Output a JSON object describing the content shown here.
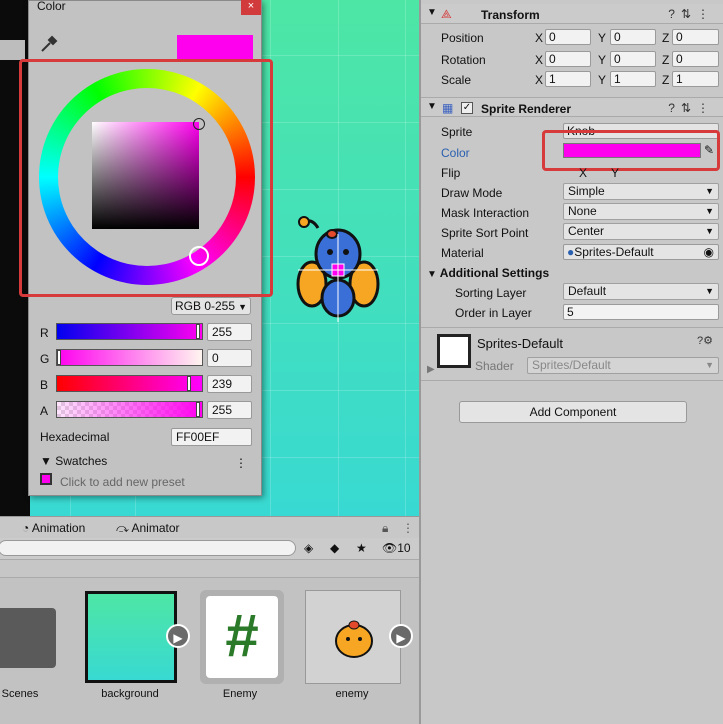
{
  "picker": {
    "title": "Color",
    "close": "×",
    "mode": "RGB 0-255",
    "channels": [
      {
        "label": "R",
        "value": "255",
        "fill": 1.0
      },
      {
        "label": "G",
        "value": "0",
        "fill": 0.0
      },
      {
        "label": "B",
        "value": "239",
        "fill": 0.937
      },
      {
        "label": "A",
        "value": "255",
        "fill": 1.0
      }
    ],
    "hex_label": "Hexadecimal",
    "hex_value": "FF00EF",
    "swatches_label": "Swatches",
    "swatches_more": "⋮",
    "swatch_hint": "Click to add new preset",
    "color": "#ff00ef"
  },
  "bottom": {
    "tabs": [
      "Animation",
      "Animator"
    ],
    "hidden_count": "10",
    "assets": [
      {
        "label": "Scenes",
        "icon": "folder-icon"
      },
      {
        "label": "background",
        "icon": "image-icon"
      },
      {
        "label": "Enemy",
        "icon": "script-icon"
      },
      {
        "label": "enemy",
        "icon": "sprite-icon"
      }
    ]
  },
  "inspector": {
    "transform": {
      "title": "Transform",
      "rows": [
        {
          "label": "Position",
          "x": "0",
          "y": "0",
          "z": "0"
        },
        {
          "label": "Rotation",
          "x": "0",
          "y": "0",
          "z": "0"
        },
        {
          "label": "Scale",
          "x": "1",
          "y": "1",
          "z": "1"
        }
      ],
      "axes": [
        "X",
        "Y",
        "Z"
      ]
    },
    "sprite_renderer": {
      "title": "Sprite Renderer",
      "sprite_label": "Sprite",
      "sprite_value": "Knob",
      "color_label": "Color",
      "flip_label": "Flip",
      "flip_x": "X",
      "flip_y": "Y",
      "draw_mode_label": "Draw Mode",
      "draw_mode_value": "Simple",
      "mask_label": "Mask Interaction",
      "mask_value": "None",
      "sort_point_label": "Sprite Sort Point",
      "sort_point_value": "Center",
      "material_label": "Material",
      "material_value": "Sprites-Default",
      "additional_label": "Additional Settings",
      "sorting_layer_label": "Sorting Layer",
      "sorting_layer_value": "Default",
      "order_label": "Order in Layer",
      "order_value": "5"
    },
    "material": {
      "title": "Sprites-Default",
      "shader_label": "Shader",
      "shader_value": "Sprites/Default"
    },
    "add_component": "Add Component"
  }
}
